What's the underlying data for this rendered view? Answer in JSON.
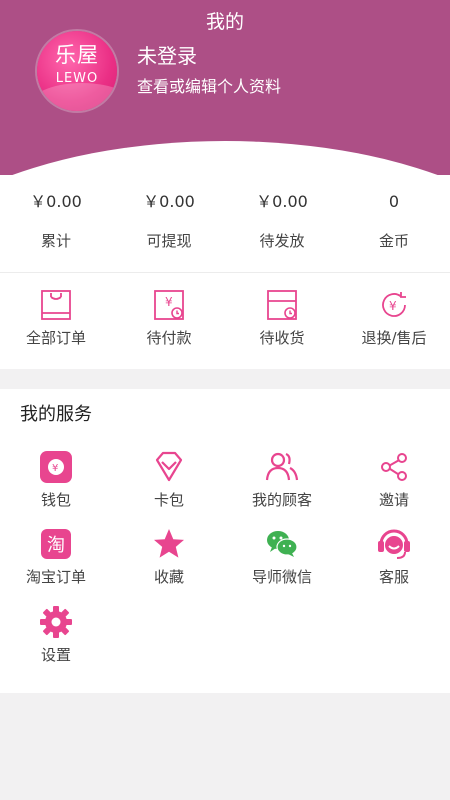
{
  "header": {
    "title": "我的",
    "logo_cn": "乐屋",
    "logo_en": "LEWO",
    "user_name": "未登录",
    "user_subtitle": "查看或编辑个人资料"
  },
  "stats": [
    {
      "value": "￥0.00",
      "label": "累计"
    },
    {
      "value": "￥0.00",
      "label": "可提现"
    },
    {
      "value": "￥0.00",
      "label": "待发放"
    },
    {
      "value": "0",
      "label": "金币"
    }
  ],
  "orders": [
    {
      "label": "全部订单",
      "icon": "all-orders-icon"
    },
    {
      "label": "待付款",
      "icon": "pending-payment-icon"
    },
    {
      "label": "待收货",
      "icon": "pending-receipt-icon"
    },
    {
      "label": "退换/售后",
      "icon": "refund-icon"
    }
  ],
  "services": {
    "title": "我的服务",
    "items": [
      {
        "label": "钱包",
        "icon": "wallet-icon"
      },
      {
        "label": "卡包",
        "icon": "card-icon"
      },
      {
        "label": "我的顾客",
        "icon": "customers-icon"
      },
      {
        "label": "邀请",
        "icon": "share-icon"
      },
      {
        "label": "淘宝订单",
        "icon": "taobao-icon",
        "glyph": "淘"
      },
      {
        "label": "收藏",
        "icon": "star-icon"
      },
      {
        "label": "导师微信",
        "icon": "wechat-icon"
      },
      {
        "label": "客服",
        "icon": "customer-service-icon"
      },
      {
        "label": "设置",
        "icon": "gear-icon"
      }
    ]
  },
  "colors": {
    "header_bg": "#ad4f86",
    "accent_pink": "#e8458f",
    "wechat_green": "#3fb152"
  }
}
